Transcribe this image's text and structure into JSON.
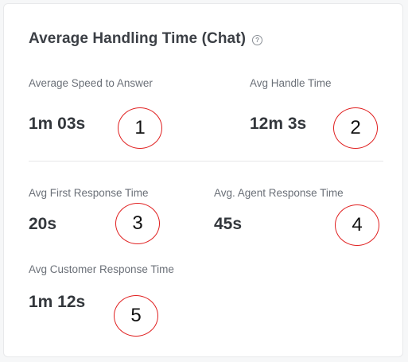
{
  "card": {
    "title": "Average Handling Time (Chat)",
    "help_icon_glyph": "?"
  },
  "metrics": [
    {
      "label": "Average Speed to Answer",
      "value": "1m 03s"
    },
    {
      "label": "Avg Handle Time",
      "value": "12m 3s"
    },
    {
      "label": "Avg First Response Time",
      "value": "20s"
    },
    {
      "label": "Avg. Agent Response Time",
      "value": "45s"
    },
    {
      "label": "Avg Customer Response Time",
      "value": "1m 12s"
    }
  ],
  "annotations": [
    "1",
    "2",
    "3",
    "4",
    "5"
  ],
  "colors": {
    "annotation_circle": "#e02020",
    "title_text": "#3b3f45",
    "label_text": "#6b7078",
    "value_text": "#33373c"
  }
}
